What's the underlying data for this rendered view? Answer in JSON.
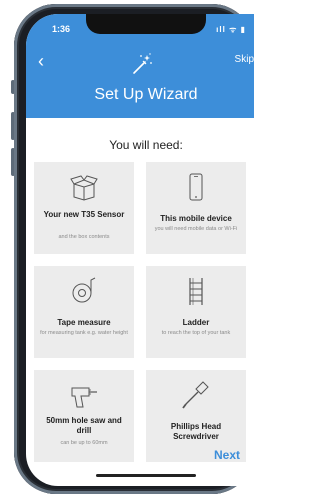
{
  "status_bar": {
    "time": "1:36",
    "icons": "ıll ᯤ ▮"
  },
  "header": {
    "back_glyph": "‹",
    "skip_label": "Skip",
    "title": "Set Up Wizard",
    "icon": "magic-wand-icon"
  },
  "content": {
    "subtitle": "You will need:",
    "items": [
      {
        "icon": "box-icon",
        "label": "Your new T35 Sensor",
        "note": "and the box contents"
      },
      {
        "icon": "phone-icon",
        "label": "This mobile device",
        "note": "you will need mobile data or Wi-Fi"
      },
      {
        "icon": "tape-measure-icon",
        "label": "Tape measure",
        "note": "for measuring tank e.g. water height"
      },
      {
        "icon": "ladder-icon",
        "label": "Ladder",
        "note": "to reach the top of your tank"
      },
      {
        "icon": "drill-icon",
        "label": "50mm hole saw and drill",
        "note": "can be up to 60mm"
      },
      {
        "icon": "screwdriver-icon",
        "label": "Phillips Head Screwdriver",
        "note": ""
      }
    ]
  },
  "footer": {
    "next_label": "Next"
  },
  "colors": {
    "primary": "#3d8ed9",
    "card_bg": "#ececec"
  }
}
